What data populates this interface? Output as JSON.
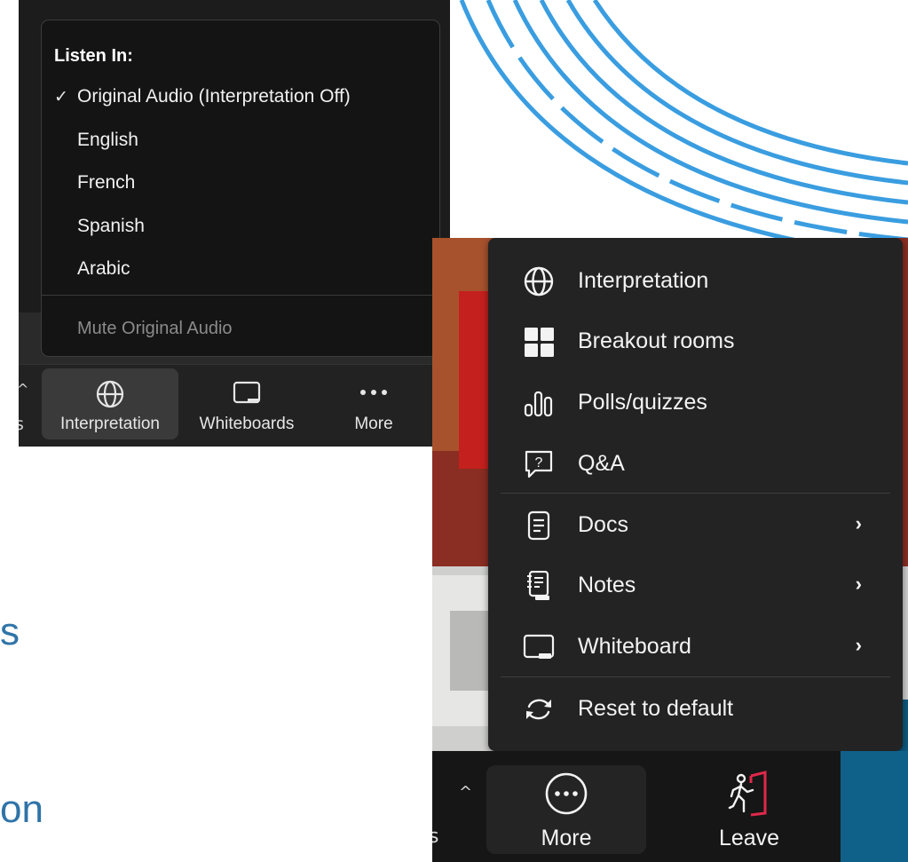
{
  "slide": {
    "fragment_1": "s",
    "fragment_2": "on"
  },
  "listen_menu": {
    "title": "Listen In:",
    "check_mark": "✓",
    "items": [
      {
        "label": "Original Audio (Interpretation Off)",
        "selected": true
      },
      {
        "label": "English",
        "selected": false
      },
      {
        "label": "French",
        "selected": false
      },
      {
        "label": "Spanish",
        "selected": false
      },
      {
        "label": "Arabic",
        "selected": false
      }
    ],
    "mute_original": "Mute Original Audio"
  },
  "toolbar_small": {
    "caret": "^",
    "partial_label": "s",
    "items": [
      {
        "label": "Interpretation",
        "icon": "globe-icon",
        "active": true
      },
      {
        "label": "Whiteboards",
        "icon": "whiteboard-icon",
        "active": false
      },
      {
        "label": "More",
        "icon": "ellipsis-icon",
        "active": false
      }
    ]
  },
  "more_menu": {
    "items": [
      {
        "label": "Interpretation",
        "icon": "globe-icon",
        "submenu": false
      },
      {
        "label": "Breakout rooms",
        "icon": "grid-icon",
        "submenu": false
      },
      {
        "label": "Polls/quizzes",
        "icon": "poll-icon",
        "submenu": false
      },
      {
        "label": "Q&A",
        "icon": "question-bubble-icon",
        "submenu": false
      },
      {
        "label": "Docs",
        "icon": "document-icon",
        "submenu": true
      },
      {
        "label": "Notes",
        "icon": "notes-icon",
        "submenu": true
      },
      {
        "label": "Whiteboard",
        "icon": "whiteboard-icon",
        "submenu": true
      },
      {
        "label": "Reset to default",
        "icon": "refresh-icon",
        "submenu": false
      }
    ],
    "chevron": "›"
  },
  "toolbar_large": {
    "caret": "^",
    "partial_label": "s",
    "more_label": "More",
    "leave_label": "Leave"
  },
  "colors": {
    "accent_blue": "#3a9de0",
    "slide_text": "#2f74a8",
    "leave_red": "#e0284a",
    "menu_bg": "#232324"
  }
}
